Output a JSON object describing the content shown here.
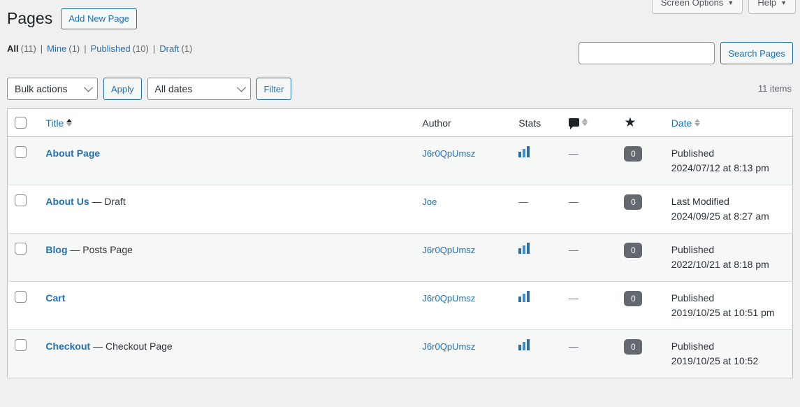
{
  "screen_meta": {
    "screen_options_label": "Screen Options",
    "help_label": "Help",
    "caret": "▼"
  },
  "header": {
    "page_title": "Pages",
    "add_new_label": "Add New Page"
  },
  "filters": {
    "items": [
      {
        "label": "All",
        "count": "(11)",
        "current": true
      },
      {
        "label": "Mine",
        "count": "(1)",
        "current": false
      },
      {
        "label": "Published",
        "count": "(10)",
        "current": false
      },
      {
        "label": "Draft",
        "count": "(1)",
        "current": false
      }
    ],
    "separator": "|"
  },
  "search": {
    "value": "",
    "placeholder": "",
    "submit_label": "Search Pages"
  },
  "tablenav": {
    "bulk_actions_value": "Bulk actions",
    "apply_label": "Apply",
    "all_dates_value": "All dates",
    "filter_label": "Filter",
    "displaying_num": "11 items"
  },
  "table": {
    "columns": {
      "title": "Title",
      "author": "Author",
      "stats": "Stats",
      "comments_icon": "comment-bubble-icon",
      "star_icon": "★",
      "date": "Date"
    },
    "rows": [
      {
        "title": "About Page",
        "state": "",
        "author": "J6r0QpUmsz",
        "stats": "bar-chart",
        "star": "—",
        "comments": "0",
        "date_status": "Published",
        "date_value": "2024/07/12 at 8:13 pm"
      },
      {
        "title": "About Us",
        "state": "— Draft",
        "author": "Joe",
        "stats": "—",
        "star": "—",
        "comments": "0",
        "date_status": "Last Modified",
        "date_value": "2024/09/25 at 8:27 am"
      },
      {
        "title": "Blog",
        "state": "— Posts Page",
        "author": "J6r0QpUmsz",
        "stats": "bar-chart",
        "star": "—",
        "comments": "0",
        "date_status": "Published",
        "date_value": "2022/10/21 at 8:18 pm"
      },
      {
        "title": "Cart",
        "state": "",
        "author": "J6r0QpUmsz",
        "stats": "bar-chart",
        "star": "—",
        "comments": "0",
        "date_status": "Published",
        "date_value": "2019/10/25 at 10:51 pm"
      },
      {
        "title": "Checkout",
        "state": "— Checkout Page",
        "author": "J6r0QpUmsz",
        "stats": "bar-chart",
        "star": "—",
        "comments": "0",
        "date_status": "Published",
        "date_value": "2019/10/25 at 10:52"
      }
    ]
  },
  "colors": {
    "link": "#2271b1",
    "text": "#2c3338",
    "muted": "#646970",
    "stripe": "#f6f7f7",
    "border": "#c3c4c7",
    "badge_bg": "#646970",
    "stats_bar": "#2e6ea6"
  }
}
